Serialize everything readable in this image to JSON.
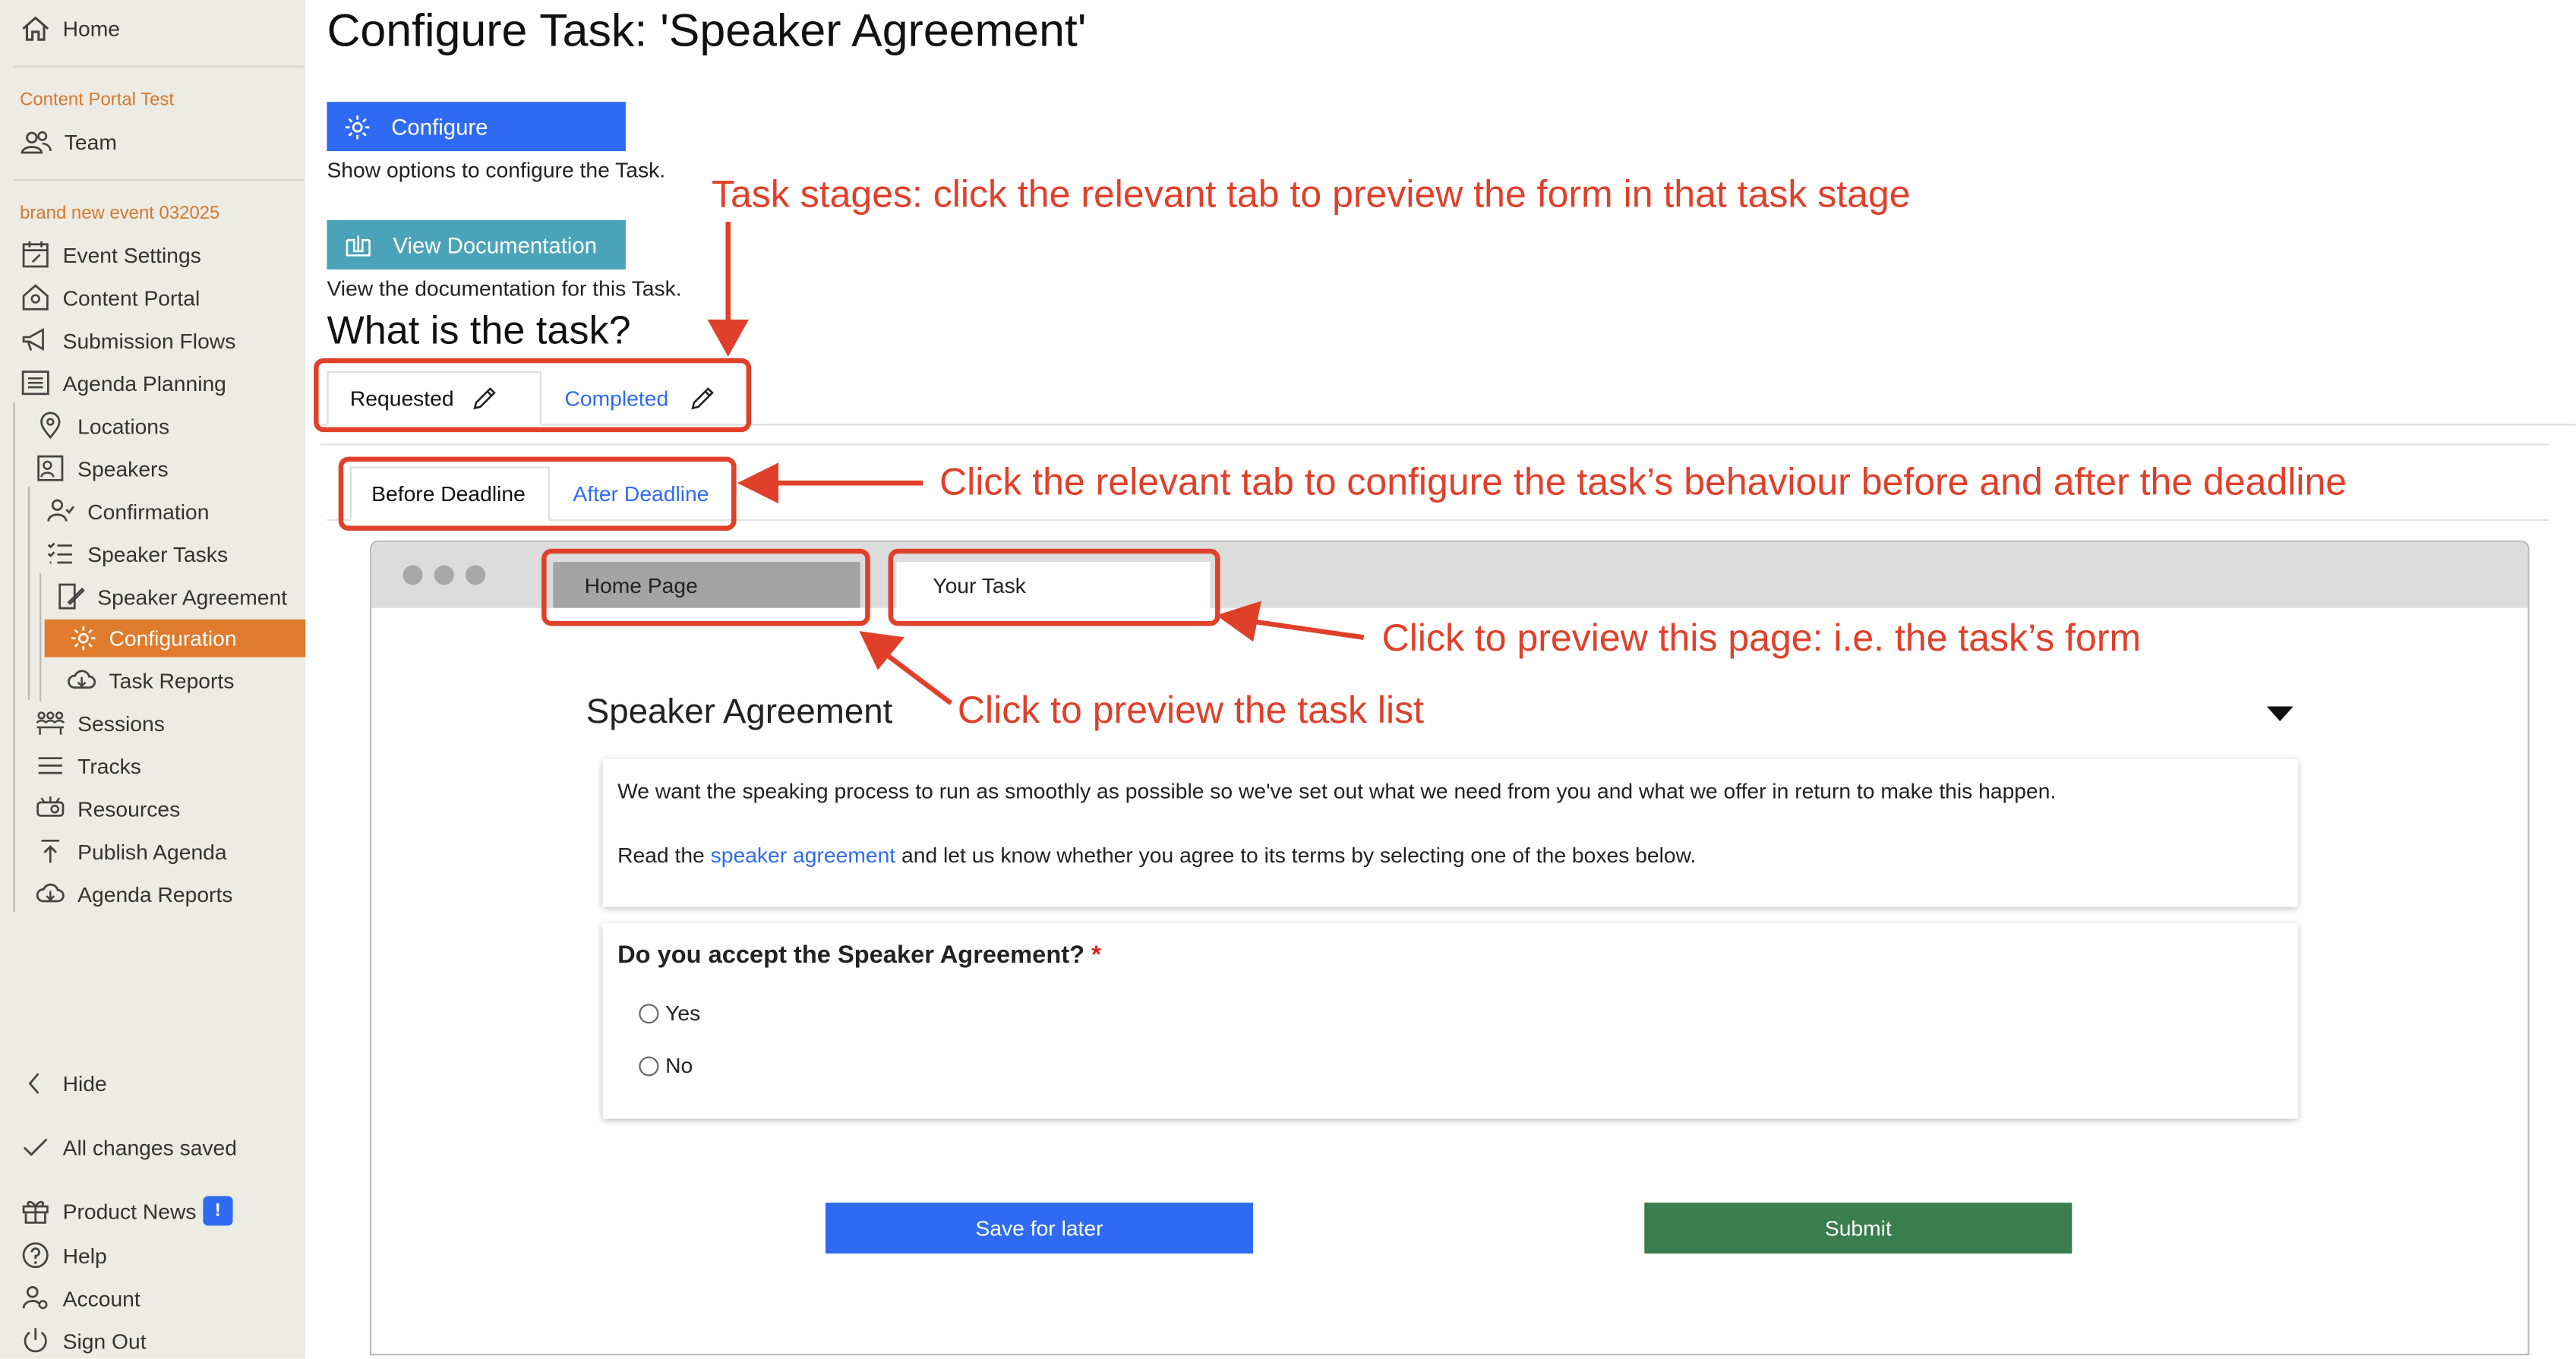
{
  "sidebar": {
    "home": "Home",
    "section1": "Content Portal Test",
    "team": "Team",
    "section2": "brand new event 032025",
    "items": [
      {
        "label": "Event Settings"
      },
      {
        "label": "Content Portal"
      },
      {
        "label": "Submission Flows"
      },
      {
        "label": "Agenda Planning"
      },
      {
        "label": "Locations"
      },
      {
        "label": "Speakers"
      },
      {
        "label": "Confirmation"
      },
      {
        "label": "Speaker Tasks"
      },
      {
        "label": "Speaker Agreement"
      },
      {
        "label": "Configuration"
      },
      {
        "label": "Task Reports"
      },
      {
        "label": "Sessions"
      },
      {
        "label": "Tracks"
      },
      {
        "label": "Resources"
      },
      {
        "label": "Publish Agenda"
      },
      {
        "label": "Agenda Reports"
      }
    ],
    "hide": "Hide",
    "saved": "All changes saved",
    "product_news": "Product News",
    "product_news_badge": "!",
    "help": "Help",
    "account": "Account",
    "sign_out": "Sign Out"
  },
  "main": {
    "title": "Configure Task: 'Speaker Agreement'",
    "configure_button": "Configure",
    "configure_desc": "Show options to configure the Task.",
    "docs_button": "View Documentation",
    "docs_desc": "View the documentation for this Task.",
    "heading": "What is the task?",
    "stage_tabs": [
      "Requested",
      "Completed"
    ],
    "deadline_tabs": [
      "Before Deadline",
      "After Deadline"
    ],
    "browser_tabs": [
      "Home Page",
      "Your Task"
    ],
    "task_title": "Speaker Agreement",
    "intro_text": "We want the speaking process to run as smoothly as possible so we've set out what we need from you and what we offer in return to make this happen.",
    "read_prefix": "Read the ",
    "read_link": "speaker agreement",
    "read_suffix": " and let us know whether you agree to its terms by selecting one of the boxes below.",
    "question": "Do you accept the Speaker Agreement?",
    "required_mark": "*",
    "options": [
      "Yes",
      "No"
    ],
    "save_button": "Save for later",
    "submit_button": "Submit"
  },
  "annotations": {
    "stages": "Task stages: click the relevant tab to preview the form in that task stage",
    "deadline": "Click the relevant tab to configure the task’s behaviour before and after the deadline",
    "preview_page": "Click to preview this page: i.e. the task’s form",
    "preview_list": "Click to preview the task list"
  },
  "colors": {
    "primary": "#2f6bf2",
    "docs": "#4aa3b8",
    "submit": "#3a7d4f",
    "active_nav": "#e07a2c",
    "annotation": "#e0402a",
    "sidebar_bg": "#ecebe4"
  }
}
